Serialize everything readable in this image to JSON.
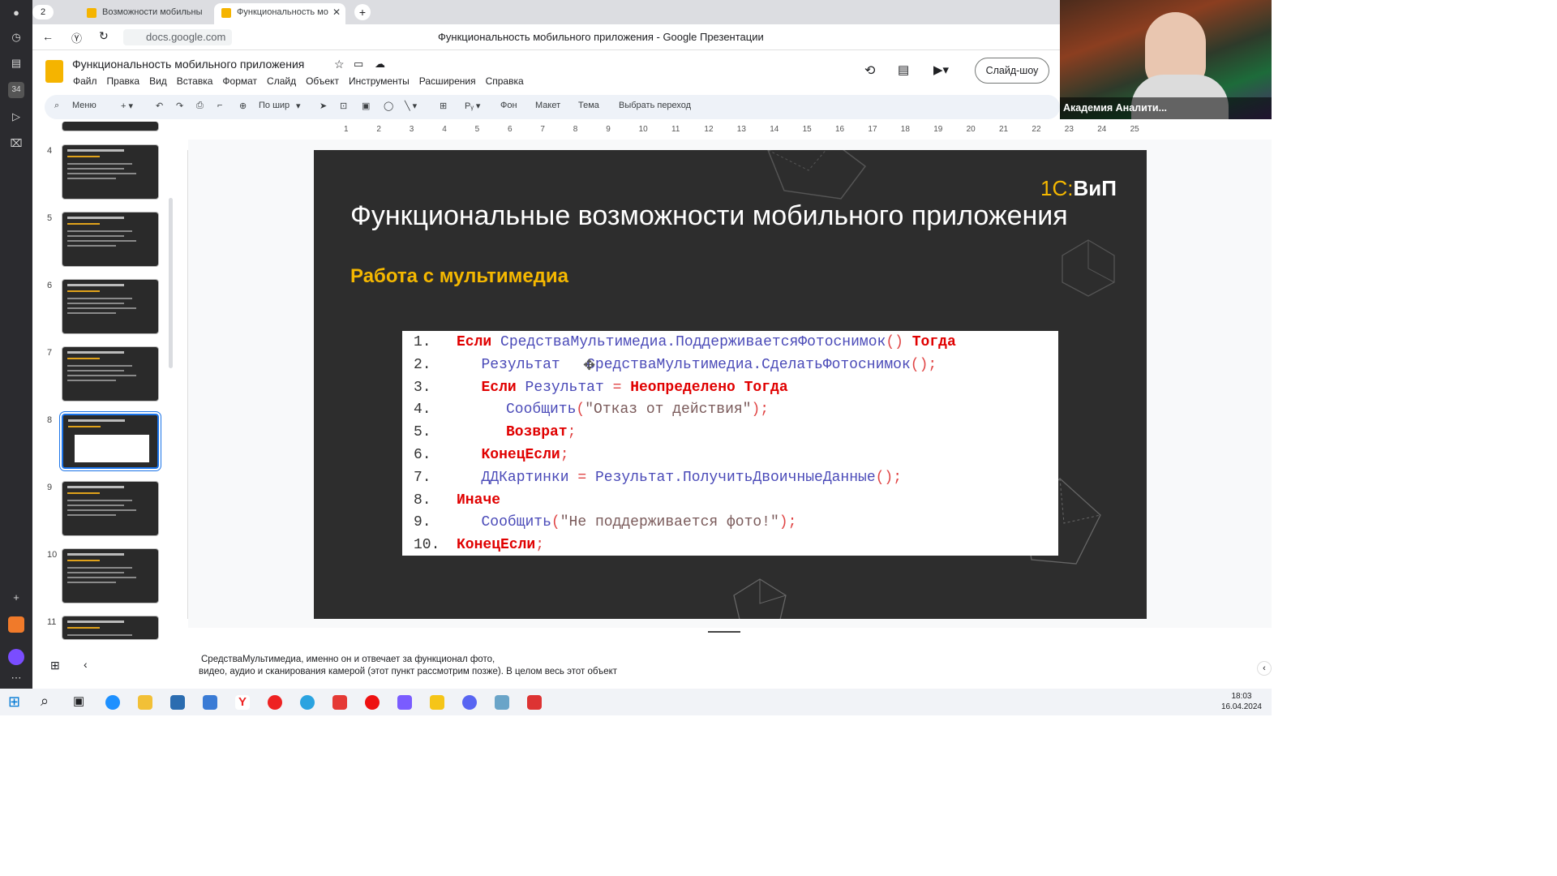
{
  "browser": {
    "tab_count": "2",
    "tabs": [
      {
        "title": "Возможности мобильны",
        "active": false
      },
      {
        "title": "Функциональность мо",
        "active": true
      }
    ],
    "url": "docs.google.com",
    "page_title": "Функциональность мобильного приложения - Google Презентации"
  },
  "docs": {
    "doc_title": "Функциональность мобильного приложения",
    "menu": [
      "Файл",
      "Правка",
      "Вид",
      "Вставка",
      "Формат",
      "Слайд",
      "Объект",
      "Инструменты",
      "Расширения",
      "Справка"
    ],
    "slideshow_button": "Слайд-шоу",
    "toolbar": {
      "search": "Меню",
      "zoom": "По шир",
      "background": "Фон",
      "layout": "Макет",
      "theme": "Тема",
      "transition": "Выбрать переход"
    },
    "ruler_numbers": [
      "1",
      "2",
      "3",
      "4",
      "5",
      "6",
      "7",
      "8",
      "9",
      "10",
      "11",
      "12",
      "13",
      "14",
      "15",
      "16",
      "17",
      "18",
      "19",
      "20",
      "21",
      "22",
      "23",
      "24",
      "25"
    ]
  },
  "filmstrip": {
    "slides": [
      {
        "num": "4",
        "selected": false
      },
      {
        "num": "5",
        "selected": false
      },
      {
        "num": "6",
        "selected": false
      },
      {
        "num": "7",
        "selected": false
      },
      {
        "num": "8",
        "selected": true
      },
      {
        "num": "9",
        "selected": false
      },
      {
        "num": "10",
        "selected": false
      },
      {
        "num": "11",
        "selected": false
      }
    ]
  },
  "slide": {
    "logo_prefix": "1С:",
    "logo_suffix": "ВиП",
    "title": "Функциональные возможности мобильного приложения",
    "subtitle": "Работа с мультимедиа",
    "code_lines": [
      {
        "n": "1.",
        "indent": 0,
        "parts": [
          [
            "kw",
            "Если"
          ],
          [
            "t",
            " "
          ],
          [
            "fn",
            "СредстваМультимедиа.ПоддерживаетсяФотоснимок"
          ],
          [
            "op",
            "()"
          ],
          [
            "t",
            " "
          ],
          [
            "kw",
            "Тогда"
          ]
        ]
      },
      {
        "n": "2.",
        "indent": 1,
        "parts": [
          [
            "fn",
            "Результат"
          ],
          [
            "t",
            "   "
          ],
          [
            "fn",
            "СредстваМультимедиа.СделатьФотоснимок"
          ],
          [
            "op",
            "();"
          ]
        ]
      },
      {
        "n": "3.",
        "indent": 1,
        "parts": [
          [
            "kw",
            "Если"
          ],
          [
            "t",
            " "
          ],
          [
            "fn",
            "Результат"
          ],
          [
            "t",
            " "
          ],
          [
            "op",
            "="
          ],
          [
            "t",
            " "
          ],
          [
            "kw",
            "Неопределено"
          ],
          [
            "t",
            " "
          ],
          [
            "kw",
            "Тогда"
          ]
        ]
      },
      {
        "n": "4.",
        "indent": 2,
        "parts": [
          [
            "fn",
            "Сообщить"
          ],
          [
            "op",
            "("
          ],
          [
            "st",
            "\"Отказ от действия\""
          ],
          [
            "op",
            ");"
          ]
        ]
      },
      {
        "n": "5.",
        "indent": 2,
        "parts": [
          [
            "kw",
            "Возврат"
          ],
          [
            "op",
            ";"
          ]
        ]
      },
      {
        "n": "6.",
        "indent": 1,
        "parts": [
          [
            "kw",
            "КонецЕсли"
          ],
          [
            "op",
            ";"
          ]
        ]
      },
      {
        "n": "7.",
        "indent": 1,
        "parts": [
          [
            "fn",
            "ДДКартинки"
          ],
          [
            "t",
            " "
          ],
          [
            "op",
            "="
          ],
          [
            "t",
            " "
          ],
          [
            "fn",
            "Результат.ПолучитьДвоичныеДанные"
          ],
          [
            "op",
            "();"
          ]
        ]
      },
      {
        "n": "8.",
        "indent": 0,
        "parts": [
          [
            "kw",
            "Иначе"
          ]
        ]
      },
      {
        "n": "9.",
        "indent": 1,
        "parts": [
          [
            "fn",
            "Сообщить"
          ],
          [
            "op",
            "("
          ],
          [
            "st",
            "\"Не поддерживается фото!\""
          ],
          [
            "op",
            ");"
          ]
        ]
      },
      {
        "n": "10.",
        "indent": 0,
        "parts": [
          [
            "kw",
            "КонецЕсли"
          ],
          [
            "op",
            ";"
          ]
        ]
      }
    ]
  },
  "notes": {
    "line1": "СредстваМультимедиа, именно он и отвечает за функционал фото,",
    "line2": "видео, аудио и сканирования камерой (этот пункт рассмотрим позже). В целом весь этот объект"
  },
  "webcam": {
    "label": "Академия Аналити..."
  },
  "taskbar": {
    "time": "18:03",
    "date": "16.04.2024"
  },
  "colors": {
    "accent_yellow": "#f5b800",
    "slide_bg": "#2d2d2d",
    "keyword_red": "#e00000",
    "function_blue": "#4a4ab8",
    "selected_blue": "#1a73e8"
  }
}
